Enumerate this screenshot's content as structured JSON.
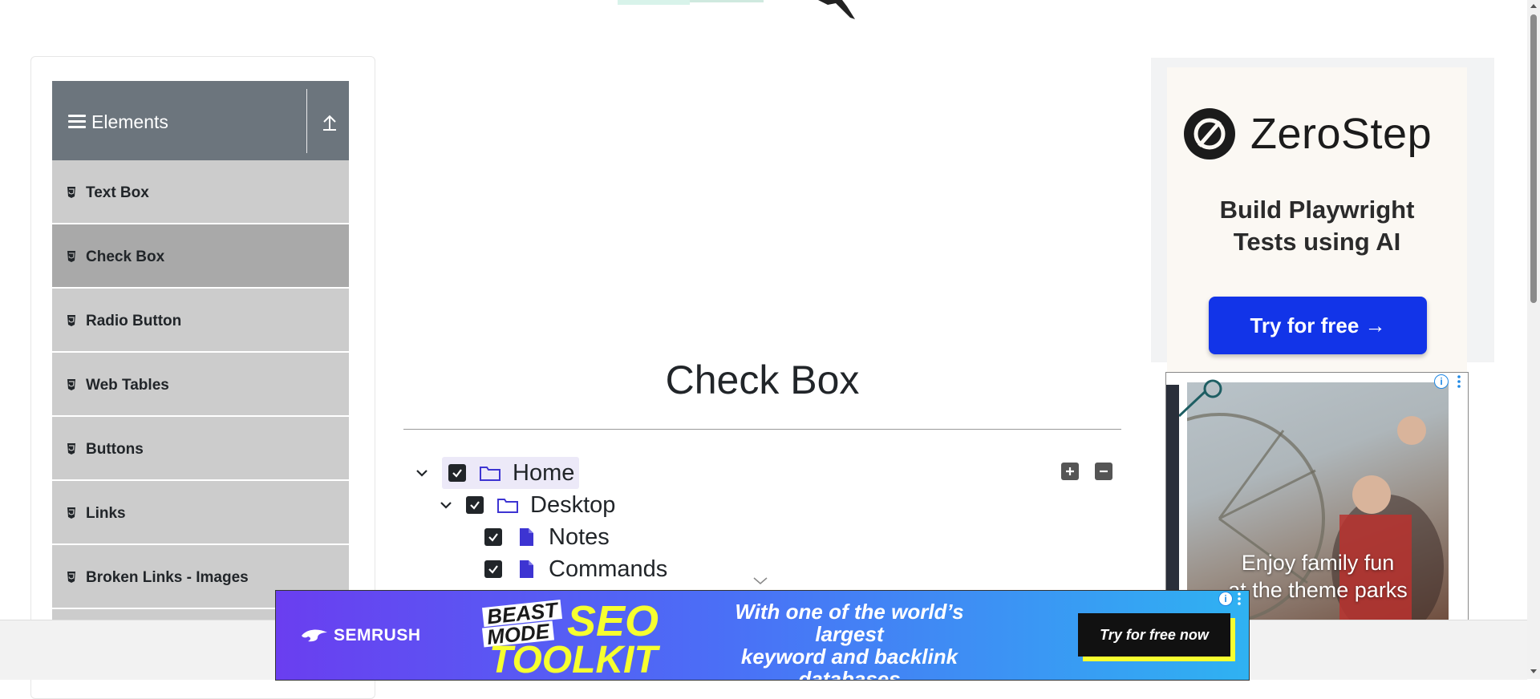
{
  "sidebar": {
    "group_title": "Elements",
    "items": [
      {
        "label": "Text Box",
        "active": false
      },
      {
        "label": "Check Box",
        "active": true
      },
      {
        "label": "Radio Button",
        "active": false
      },
      {
        "label": "Web Tables",
        "active": false
      },
      {
        "label": "Buttons",
        "active": false
      },
      {
        "label": "Links",
        "active": false
      },
      {
        "label": "Broken Links - Images",
        "active": false
      }
    ]
  },
  "main": {
    "title": "Check Box",
    "tree": [
      {
        "label": "Home",
        "checked": true,
        "expanded": true,
        "type": "folder"
      },
      {
        "label": "Desktop",
        "checked": true,
        "expanded": true,
        "type": "folder"
      },
      {
        "label": "Notes",
        "checked": true,
        "type": "file"
      },
      {
        "label": "Commands",
        "checked": true,
        "type": "file"
      }
    ],
    "expand_all_icon": "plus-icon",
    "collapse_all_icon": "minus-icon"
  },
  "ads": {
    "zerostep": {
      "brand": "ZeroStep",
      "tagline_line1": "Build Playwright",
      "tagline_line2": "Tests using AI",
      "cta": "Try for free →"
    },
    "theme_park": {
      "caption_line1": "Enjoy family fun",
      "caption_line2": "at the theme parks"
    },
    "semrush": {
      "brand": "SEMRUSH",
      "beast_line1": "BEAST",
      "beast_line2": "MODE",
      "seo": "SEO",
      "toolkit": "TOOLKIT",
      "message_line1": "With one of the world’s largest",
      "message_line2": "keyword and backlink",
      "message_line3": "databases",
      "cta": "Try for free now"
    }
  },
  "colors": {
    "sidebar_header": "#6c757d",
    "menu_item": "#cccccc",
    "menu_item_active": "#a9a9a9",
    "zerostep_cta": "#1234e8",
    "semrush_yellow": "#f6ff2f"
  }
}
